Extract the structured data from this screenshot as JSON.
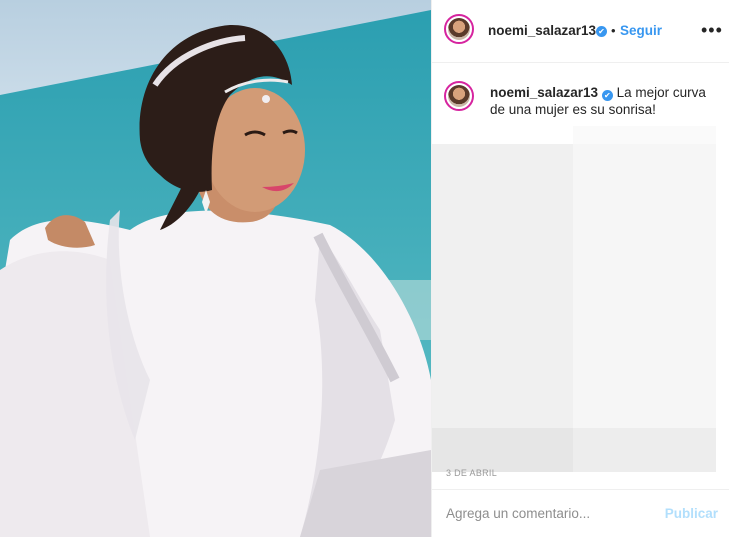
{
  "post": {
    "username": "noemi_salazar13",
    "follow_label": "Seguir",
    "more_label": "•••",
    "verified_label": "✔",
    "separator": "•",
    "caption_text": "La mejor curva de una mujer es su sonrisa!",
    "date": "3 DE ABRIL"
  },
  "comment": {
    "placeholder": "Agrega un comentario...",
    "publish_label": "Publicar"
  },
  "colors": {
    "accent": "#3897f0",
    "publish_disabled": "#b2dffc",
    "story_ring": "#d6249f"
  },
  "icons": {
    "verified": "verified-badge-icon",
    "more": "more-options-icon"
  }
}
